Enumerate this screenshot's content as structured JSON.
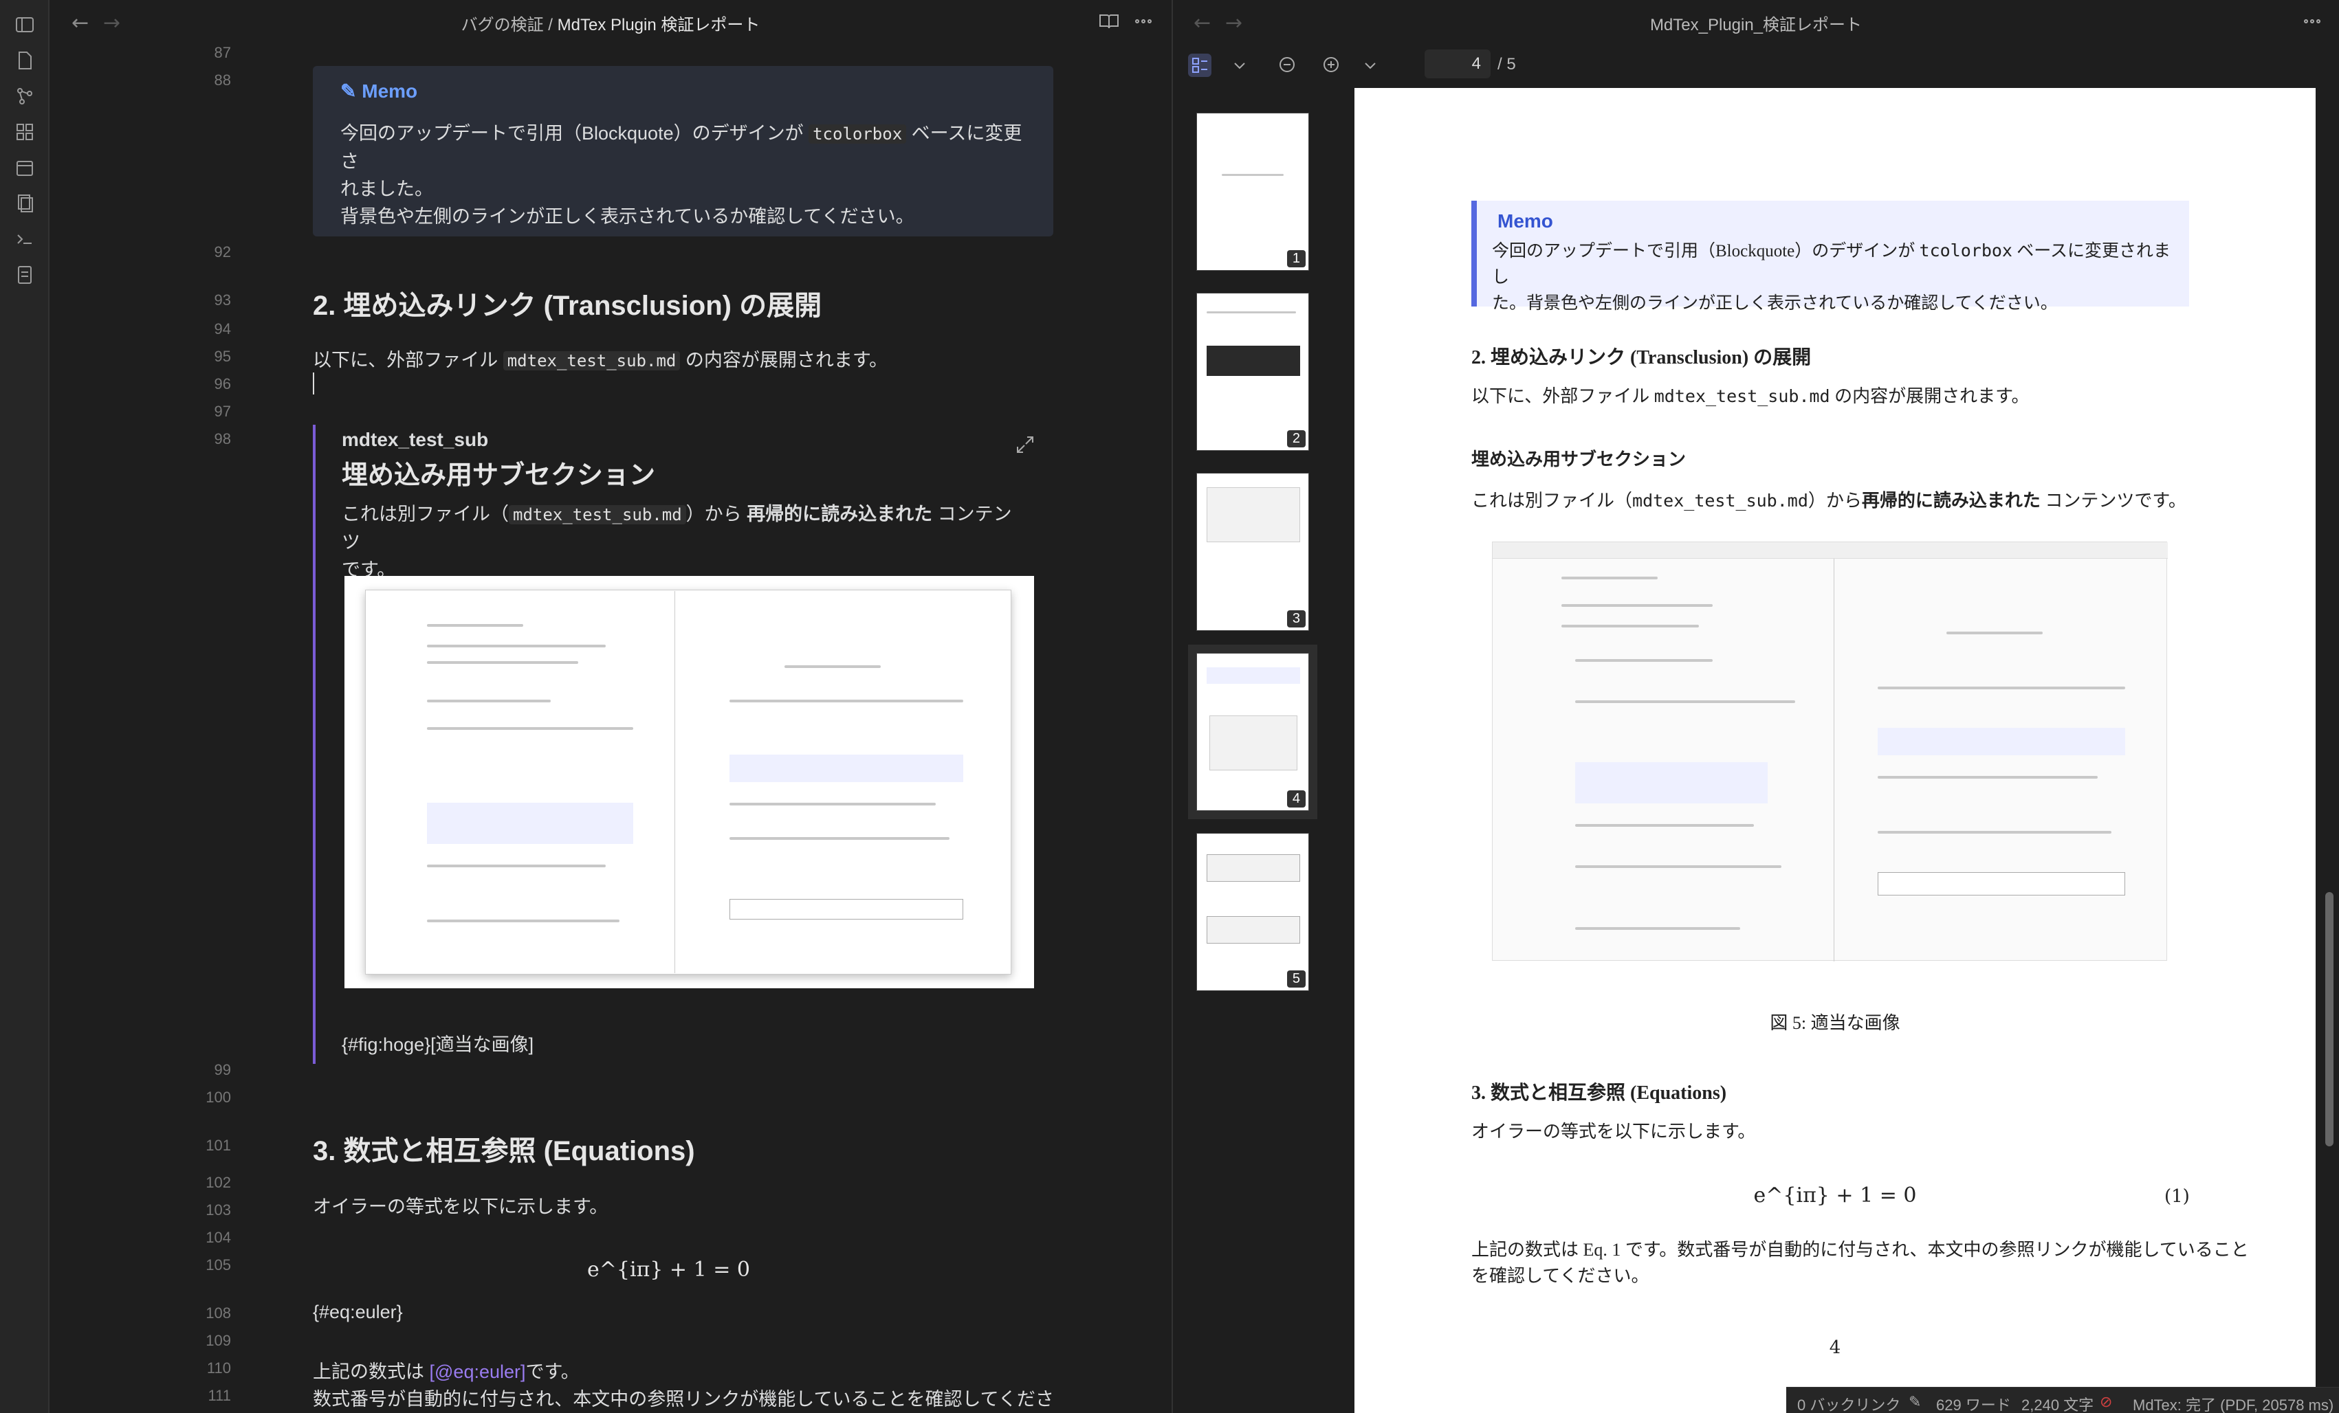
{
  "editor": {
    "breadcrumb_folder": "バグの検証",
    "breadcrumb_sep": "/",
    "breadcrumb_file": "MdTex Plugin 検証レポート",
    "line_numbers": [
      "87",
      "88",
      "92",
      "93",
      "94",
      "95",
      "96",
      "97",
      "98",
      "99",
      "100",
      "101",
      "102",
      "103",
      "104",
      "105",
      "108",
      "109",
      "110",
      "111"
    ],
    "memo_title": "Memo",
    "memo_line1_pre": "今回のアップデートで引用（Blockquote）のデザインが",
    "memo_code": "tcolorbox",
    "memo_line1_post": "ベースに変更さ",
    "memo_line2": "れました。",
    "memo_line3": "背景色や左側のラインが正しく表示されているか確認してください。",
    "h2_transclusion": "2. 埋め込みリンク (Transclusion) の展開",
    "p_transclusion_pre": "以下に、外部ファイル",
    "p_transclusion_code": "mdtex_test_sub.md",
    "p_transclusion_post": "の内容が展開されます。",
    "embed_name": "mdtex_test_sub",
    "embed_heading": "埋め込み用サブセクション",
    "embed_p_pre": "これは別ファイル（",
    "embed_p_code": "mdtex_test_sub.md",
    "embed_p_mid": "）から",
    "embed_p_bold": "再帰的に読み込まれた",
    "embed_p_post": "コンテンツ",
    "embed_p_line2": "です。",
    "embed_caption": "{#fig:hoge}[適当な画像]",
    "h2_equations": "3. 数式と相互参照 (Equations)",
    "p_euler": "オイラーの等式を以下に示します。",
    "math": "e^{iπ} + 1 = 0",
    "eq_label": "{#eq:euler}",
    "p_ref_pre": "上記の数式は",
    "p_ref_link": "[@eq:euler]",
    "p_ref_post": "です。",
    "p_ref_line2": "数式番号が自動的に付与され、本文中の参照リンクが機能していることを確認してくださ"
  },
  "pdf": {
    "title": "MdTex_Plugin_検証レポート",
    "page_current": "4",
    "page_total": "/ 5",
    "thumbs": [
      "1",
      "2",
      "3",
      "4",
      "5"
    ],
    "memo_title": "Memo",
    "memo_body_pre": "今回のアップデートで引用（Blockquote）のデザインが",
    "memo_body_code": "tcolorbox",
    "memo_body_post": "ベースに変更されまし",
    "memo_body_line2": "た。背景色や左側のラインが正しく表示されているか確認してください。",
    "h_transclusion": "2. 埋め込みリンク (Transclusion) の展開",
    "p_transclusion_pre": "以下に、外部ファイル",
    "p_transclusion_code": "mdtex_test_sub.md",
    "p_transclusion_post": "の内容が展開されます。",
    "h_sub": "埋め込み用サブセクション",
    "p_sub_pre": "これは別ファイル（",
    "p_sub_code": "mdtex_test_sub.md",
    "p_sub_mid": "）から",
    "p_sub_bold": "再帰的に読み込まれた",
    "p_sub_post": "コンテンツです。",
    "caption": "図 5: 適当な画像",
    "h_equations": "3. 数式と相互参照 (Equations)",
    "p_euler": "オイラーの等式を以下に示します。",
    "equation": "e^{iπ} + 1 = 0",
    "eq_number": "(1)",
    "p_ref_line1": "上記の数式は Eq. 1 です。数式番号が自動的に付与され、本文中の参照リンクが機能していること",
    "p_ref_line2": "を確認してください。",
    "page_number": "4"
  },
  "statusbar": {
    "backlinks": "0 バックリンク",
    "words": "629 ワード",
    "chars": "2,240 文字",
    "mdtex": "MdTex: 完了 (PDF, 20578 ms)"
  }
}
